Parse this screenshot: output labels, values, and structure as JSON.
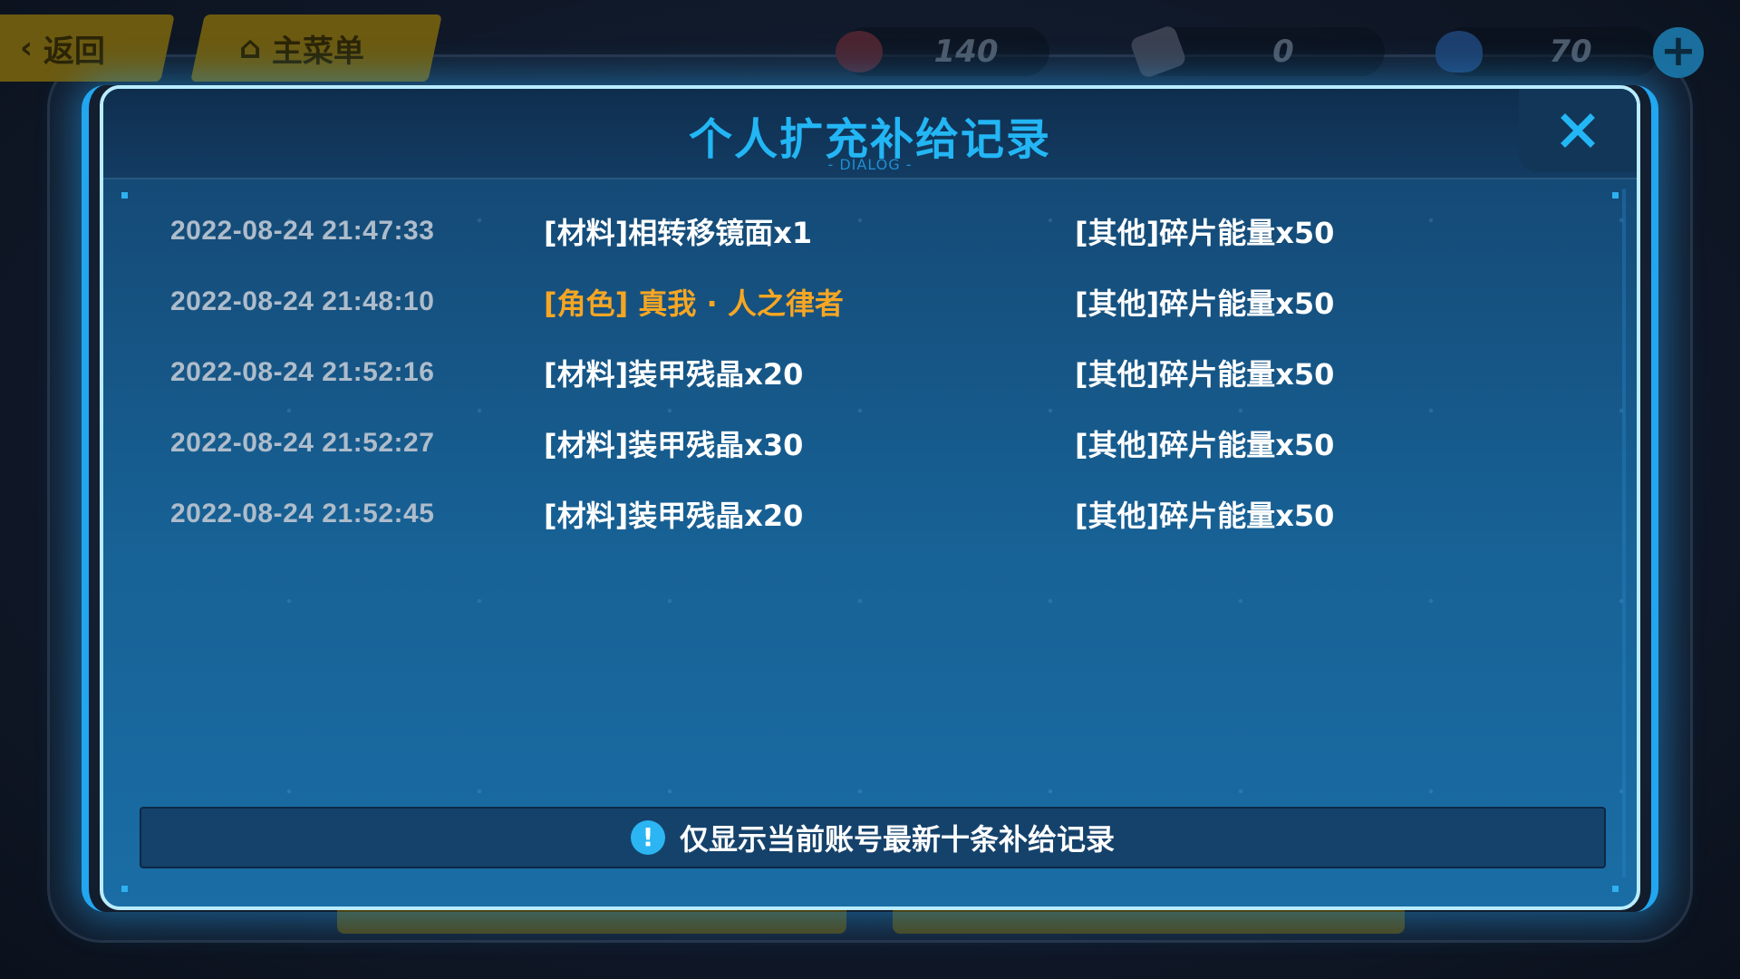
{
  "nav": {
    "back_label": "返回",
    "home_label": "主菜单"
  },
  "currencies": [
    {
      "icon": "currency-crystal-icon",
      "value": "140"
    },
    {
      "icon": "currency-ticket-icon",
      "value": "0"
    },
    {
      "icon": "currency-shield-icon",
      "value": "70"
    }
  ],
  "dialog": {
    "title": "个人扩充补给记录",
    "subtitle": "- DIALOG -",
    "close_glyph": "✕",
    "records": [
      {
        "time": "2022-08-24 21:47:33",
        "item": "[材料]相转移镜面x1",
        "bonus": "[其他]碎片能量x50",
        "highlight": false
      },
      {
        "time": "2022-08-24 21:48:10",
        "item": "[角色] 真我 · 人之律者",
        "bonus": "[其他]碎片能量x50",
        "highlight": true
      },
      {
        "time": "2022-08-24 21:52:16",
        "item": "[材料]装甲残晶x20",
        "bonus": "[其他]碎片能量x50",
        "highlight": false
      },
      {
        "time": "2022-08-24 21:52:27",
        "item": "[材料]装甲残晶x30",
        "bonus": "[其他]碎片能量x50",
        "highlight": false
      },
      {
        "time": "2022-08-24 21:52:45",
        "item": "[材料]装甲残晶x20",
        "bonus": "[其他]碎片能量x50",
        "highlight": false
      }
    ],
    "notice": {
      "icon_glyph": "!",
      "text": "仅显示当前账号最新十条补给记录"
    }
  },
  "colors": {
    "title": "#23b6f5",
    "highlight": "#f6a623",
    "dialog_border": "#b9ecff"
  }
}
